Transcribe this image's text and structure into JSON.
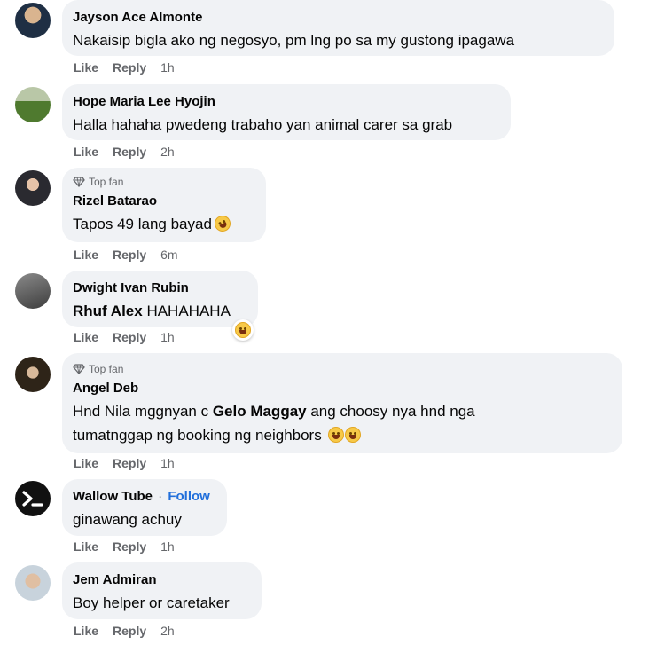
{
  "comments": [
    {
      "author": "Jayson Ace Almonte",
      "text": "Nakaisip bigla ako ng negosyo, pm lng po sa my gustong ipagawa",
      "like": "Like",
      "reply": "Reply",
      "time": "1h"
    },
    {
      "author": "Hope Maria Lee Hyojin",
      "text": "Halla hahaha pwedeng trabaho yan animal carer sa grab",
      "like": "Like",
      "reply": "Reply",
      "time": "2h"
    },
    {
      "badge": "Top fan",
      "author": "Rizel Batarao",
      "text": "Tapos 49 lang bayad",
      "like": "Like",
      "reply": "Reply",
      "time": "6m"
    },
    {
      "author": "Dwight Ivan Rubin",
      "mention": "Rhuf Alex",
      "text": " HAHAHAHA",
      "like": "Like",
      "reply": "Reply",
      "time": "1h"
    },
    {
      "badge": "Top fan",
      "author": "Angel Deb",
      "text_pre": "Hnd Nila mggnyan c ",
      "mention": "Gelo Maggay",
      "text_post": " ang choosy nya hnd nga",
      "text_line2": "tumatnggap ng booking ng neighbors",
      "like": "Like",
      "reply": "Reply",
      "time": "1h"
    },
    {
      "author": "Wallow Tube",
      "separator": "·",
      "follow": "Follow",
      "text": "ginawang achuy",
      "like": "Like",
      "reply": "Reply",
      "time": "1h"
    },
    {
      "author": "Jem Admiran",
      "text": "Boy helper or caretaker",
      "like": "Like",
      "reply": "Reply",
      "time": "2h"
    }
  ],
  "icons": {
    "badge": "diamond-icon",
    "emoji_laugh": "rolling-laughing-emoji-icon",
    "emoji_grin": "grinning-emoji-icon",
    "reaction": "haha-reaction-icon"
  },
  "colors": {
    "bubble": "#f0f2f5",
    "secondary_text": "#65676b",
    "follow": "#216fdb"
  }
}
